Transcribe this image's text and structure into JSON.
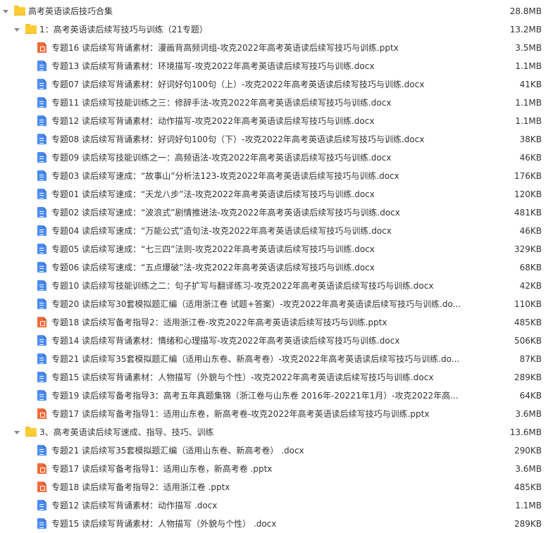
{
  "root": {
    "name": "高考英语读后技巧合集",
    "size": "28.8MB"
  },
  "folder1": {
    "name": "1：高考英语读后续写技巧与训练（21专题）",
    "size": "13.2MB",
    "files": [
      {
        "name": "专题16 读后续写背诵素材：漫画背高频词组-攻克2022年高考英语读后续写技巧与训练.pptx",
        "size": "3.5MB",
        "type": "pptx"
      },
      {
        "name": "专题13 读后续写背诵素材：环境描写-攻克2022年高考英语读后续写技巧与训练.docx",
        "size": "1.1MB",
        "type": "docx"
      },
      {
        "name": "专题07 读后续写背诵素材：好词好句100句（上）-攻克2022年高考英语读后续写技巧与训练.docx",
        "size": "41KB",
        "type": "docx"
      },
      {
        "name": "专题11 读后续写技能训练之三：修辞手法-攻克2022年高考英语读后续写技巧与训练.docx",
        "size": "1.1MB",
        "type": "docx"
      },
      {
        "name": "专题12 读后续写背诵素材：动作描写-攻克2022年高考英语读后续写技巧与训练.docx",
        "size": "1.1MB",
        "type": "docx"
      },
      {
        "name": "专题08 读后续写背诵素材：好词好句100句（下）-攻克2022年高考英语读后续写技巧与训练.docx",
        "size": "38KB",
        "type": "docx"
      },
      {
        "name": "专题09 读后续写技能训练之一：高频语法-攻克2022年高考英语读后续写技巧与训练.docx",
        "size": "46KB",
        "type": "docx"
      },
      {
        "name": "专题03 读后续写速成：“故事山”分析法123-攻克2022年高考英语读后续写技巧与训练.docx",
        "size": "176KB",
        "type": "docx"
      },
      {
        "name": "专题01 读后续写速成：“天龙八步”法-攻克2022年高考英语读后续写技巧与训练.docx",
        "size": "120KB",
        "type": "docx"
      },
      {
        "name": "专题02 读后续写速成：“波浪式”剧情推进法-攻克2022年高考英语读后续写技巧与训练.docx",
        "size": "481KB",
        "type": "docx"
      },
      {
        "name": "专题04 读后续写速成：“万能公式”造句法-攻克2022年高考英语读后续写技巧与训练.docx",
        "size": "46KB",
        "type": "docx"
      },
      {
        "name": "专题05 读后续写速成：“七三四”法则-攻克2022年高考英语读后续写技巧与训练.docx",
        "size": "329KB",
        "type": "docx"
      },
      {
        "name": "专题06 读后续写速成：“五点爆破”法-攻克2022年高考英语读后续写技巧与训练.docx",
        "size": "68KB",
        "type": "docx"
      },
      {
        "name": "专题10 读后续写技能训练之二：句子扩写与翻译练习-攻克2022年高考英语读后续写技巧与训练.docx",
        "size": "42KB",
        "type": "docx"
      },
      {
        "name": "专题20 读后续写30套模拟题汇编（适用浙江卷 试题+答案）-攻克2022年高考英语读后续写技巧与训练.do...",
        "size": "110KB",
        "type": "docx"
      },
      {
        "name": "专题18 读后续写备考指导2：适用浙江卷-攻克2022年高考英语读后续写技巧与训练.pptx",
        "size": "485KB",
        "type": "pptx"
      },
      {
        "name": "专题14 读后续写背诵素材：情绪和心理描写-攻克2022年高考英语读后续写技巧与训练.docx",
        "size": "506KB",
        "type": "docx"
      },
      {
        "name": "专题21 读后续写35套模拟题汇编（适用山东卷、新高考卷）-攻克2022年高考英语读后续写技巧与训练.do...",
        "size": "87KB",
        "type": "docx"
      },
      {
        "name": "专题15 读后续写背诵素材：人物描写（外貌与个性）-攻克2022年高考英语读后续写技巧与训练.docx",
        "size": "289KB",
        "type": "docx"
      },
      {
        "name": "专题19 读后续写备考指导3：高考五年真题集锦（浙江卷与山东卷 2016年-20221年1月）-攻克2022年高...",
        "size": "64KB",
        "type": "docx"
      },
      {
        "name": "专题17 读后续写备考指导1：适用山东卷，新高考卷-攻克2022年高考英语读后续写技巧与训练.pptx",
        "size": "3.6MB",
        "type": "pptx"
      }
    ]
  },
  "folder3": {
    "name": "3、高考英语读后续写速成、指导、技巧、训练",
    "size": "13.6MB",
    "files": [
      {
        "name": "专题21 读后续写35套模拟题汇编（适用山东卷、新高考卷） .docx",
        "size": "290KB",
        "type": "docx"
      },
      {
        "name": "专题17 读后续写备考指导1：适用山东卷，新高考卷 .pptx",
        "size": "3.6MB",
        "type": "pptx"
      },
      {
        "name": "专题18 读后续写备考指导2：适用浙江卷 .pptx",
        "size": "485KB",
        "type": "pptx"
      },
      {
        "name": "专题12 读后续写背诵素材：动作描写 .docx",
        "size": "1.1MB",
        "type": "docx"
      },
      {
        "name": "专题15 读后续写背诵素材：人物描写（外貌与个性） .docx",
        "size": "289KB",
        "type": "docx"
      }
    ]
  }
}
